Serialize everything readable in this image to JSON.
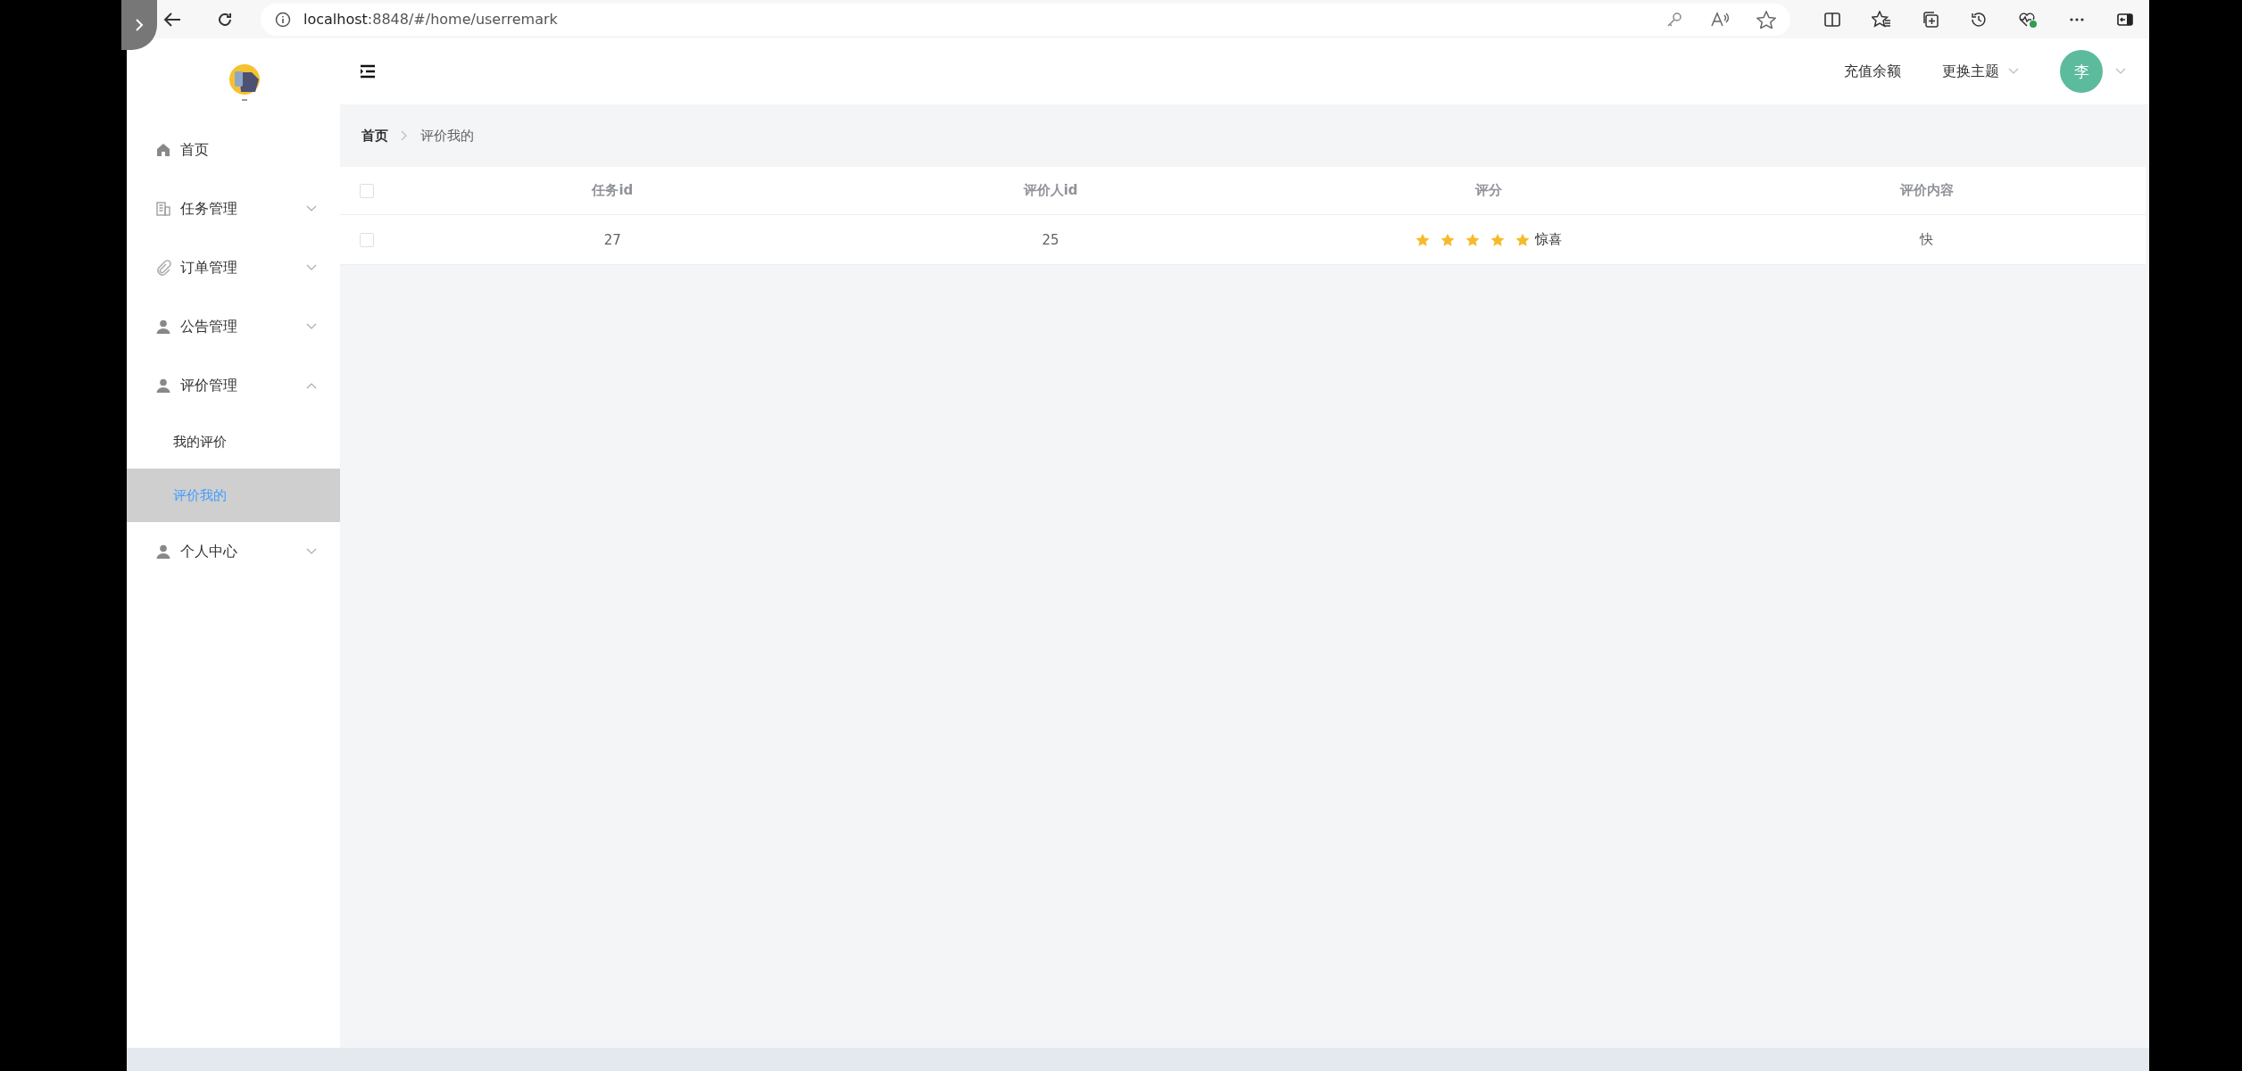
{
  "browser": {
    "url_host": "localhost",
    "url_rest": ":8848/#/home/userremark"
  },
  "header": {
    "recharge": "充值余额",
    "theme": "更换主题",
    "avatar": "李"
  },
  "sidebar": {
    "items": [
      {
        "label": "首页",
        "kind": "link"
      },
      {
        "label": "任务管理",
        "kind": "group",
        "expanded": false
      },
      {
        "label": "订单管理",
        "kind": "group",
        "expanded": false
      },
      {
        "label": "公告管理",
        "kind": "group",
        "expanded": false
      },
      {
        "label": "评价管理",
        "kind": "group",
        "expanded": true,
        "children": [
          {
            "label": "我的评价",
            "selected": false
          },
          {
            "label": "评价我的",
            "selected": true
          }
        ]
      },
      {
        "label": "个人中心",
        "kind": "group",
        "expanded": false
      }
    ]
  },
  "breadcrumb": [
    "首页",
    "评价我的"
  ],
  "table": {
    "header_checked": false,
    "columns": [
      "任务id",
      "评价人id",
      "评分",
      "评价内容"
    ],
    "rows": [
      {
        "checked": false,
        "task_id": "27",
        "reviewer_id": "25",
        "stars": 5,
        "rating_label": "惊喜",
        "content": "快"
      }
    ]
  }
}
